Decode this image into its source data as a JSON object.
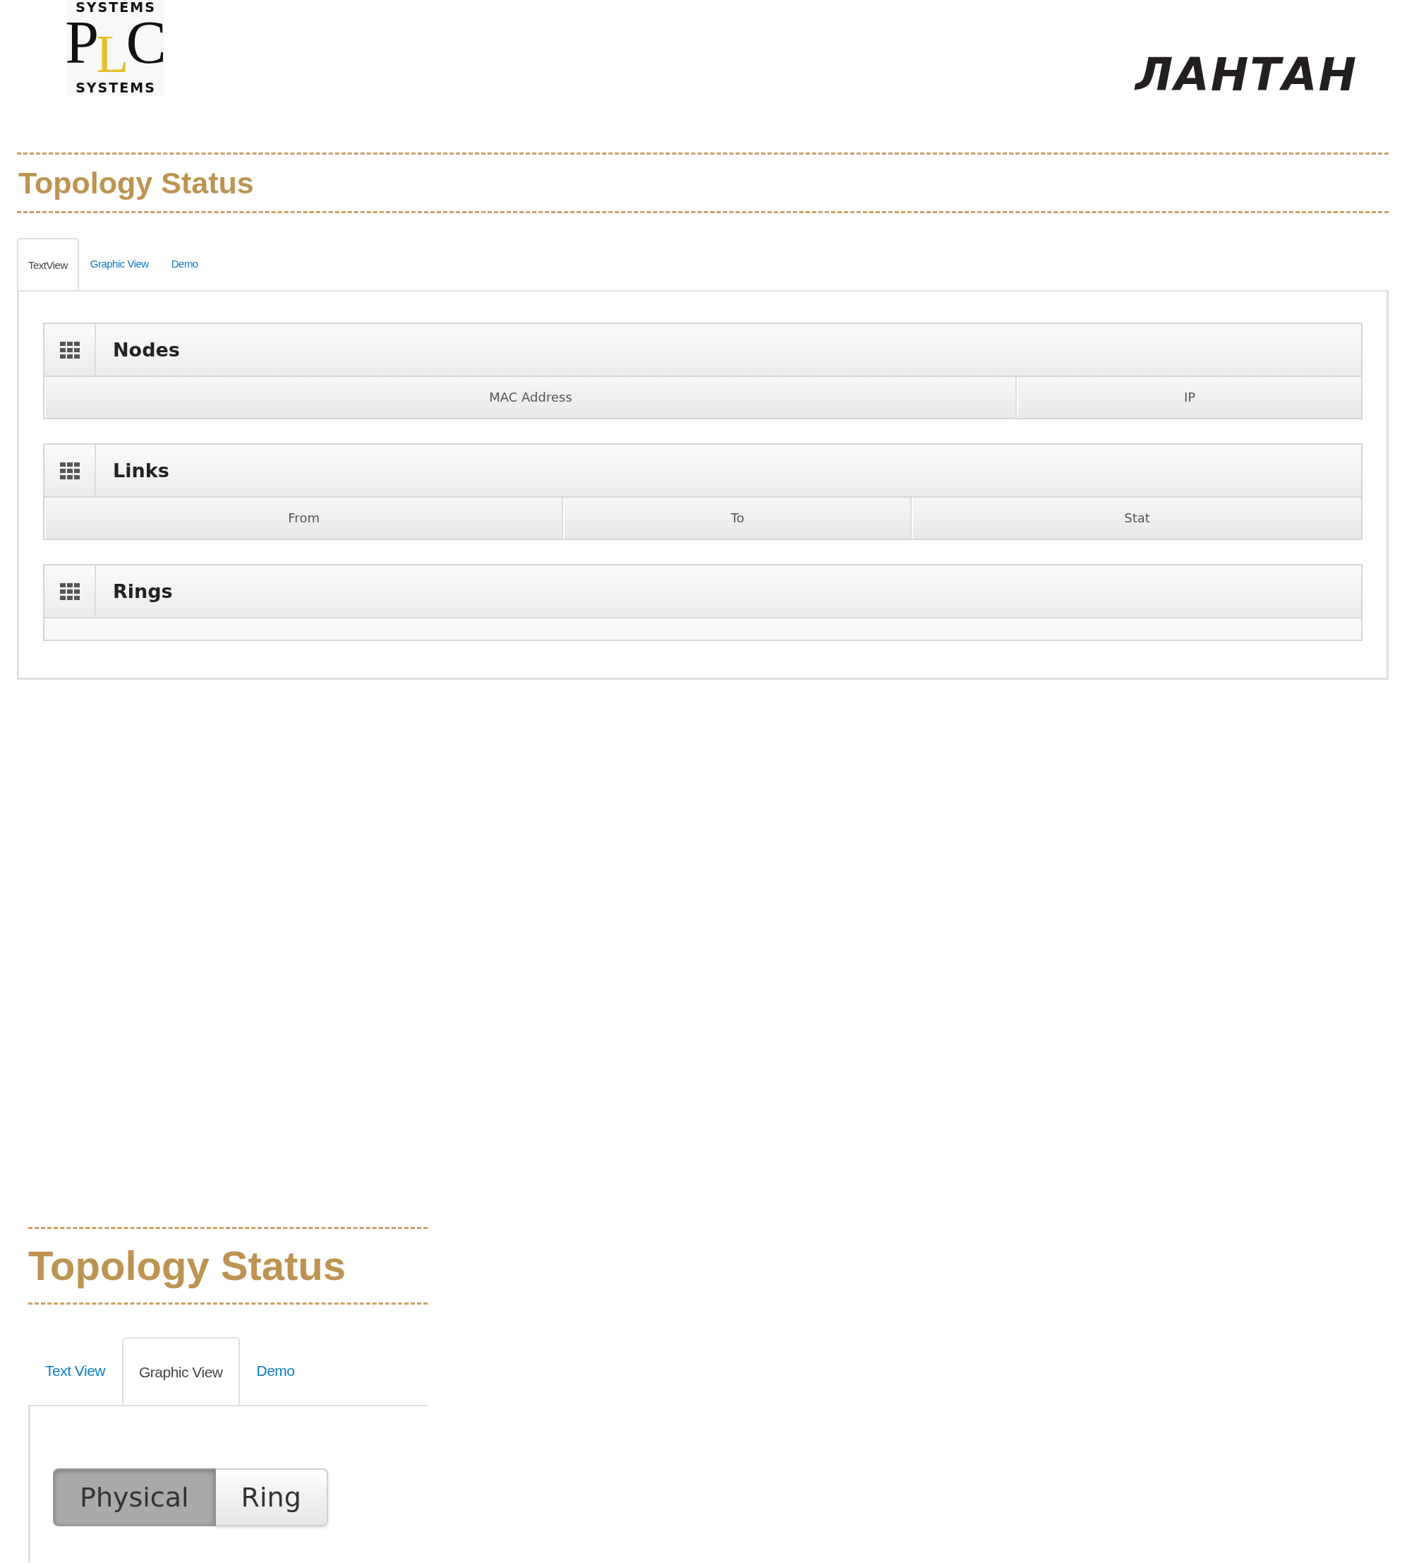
{
  "header": {
    "logo_left": {
      "top": "SYSTEMS",
      "letters": [
        "P",
        "L",
        "C"
      ],
      "bottom": "SYSTEMS"
    },
    "logo_right": "ЛАНТАН"
  },
  "screens": [
    {
      "title": "Topology Status",
      "tabs": [
        {
          "label": "TextView",
          "selected": true
        },
        {
          "label": "Graphic View",
          "selected": false
        },
        {
          "label": "Demo",
          "selected": false
        }
      ],
      "view": {
        "kind": "text",
        "sections": [
          {
            "title": "Nodes",
            "columns": [
              "MAC Address",
              "IP"
            ]
          },
          {
            "title": "Links",
            "columns": [
              "From",
              "To",
              "Stat"
            ]
          },
          {
            "title": "Rings"
          }
        ]
      }
    },
    {
      "title": "Topology Status",
      "tabs": [
        {
          "label": "Text View",
          "selected": false
        },
        {
          "label": "Graphic View",
          "selected": true
        },
        {
          "label": "Demo",
          "selected": false
        }
      ],
      "view": {
        "kind": "graphic",
        "toggle": [
          {
            "label": "Physical",
            "selected": true
          },
          {
            "label": "Ring",
            "selected": false
          }
        ]
      }
    }
  ]
}
